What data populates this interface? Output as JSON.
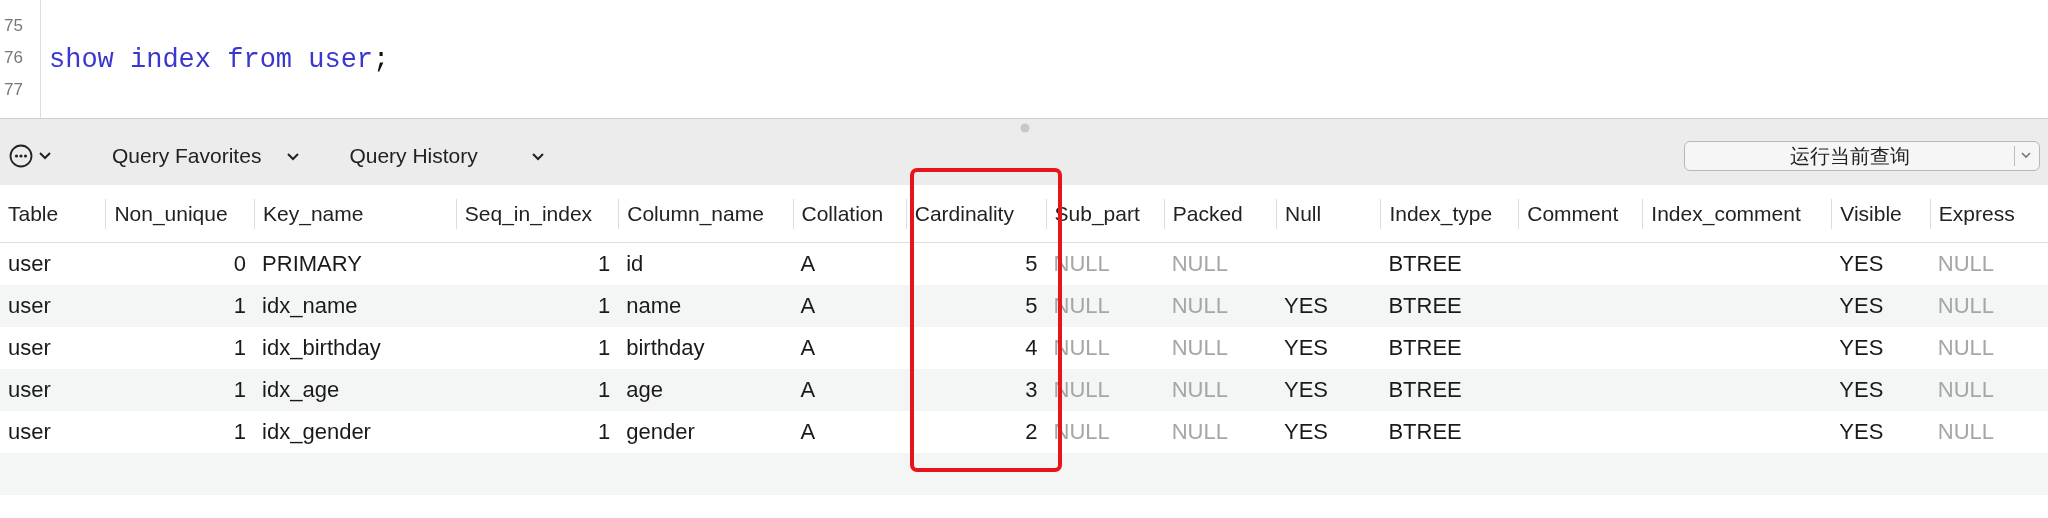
{
  "editor": {
    "lines": [
      {
        "number": "75"
      },
      {
        "number": "76",
        "code": {
          "keywords": "show index from user",
          "punct": ";"
        }
      },
      {
        "number": "77"
      }
    ]
  },
  "toolbar": {
    "favorites": "Query Favorites",
    "history": "Query History",
    "run_button": "运行当前查询"
  },
  "table": {
    "columns": [
      "Table",
      "Non_unique",
      "Key_name",
      "Seq_in_index",
      "Column_name",
      "Collation",
      "Cardinality",
      "Sub_part",
      "Packed",
      "Null",
      "Index_type",
      "Comment",
      "Index_comment",
      "Visible",
      "Express"
    ],
    "rows": [
      [
        "user",
        "0",
        "PRIMARY",
        "1",
        "id",
        "A",
        "5",
        {
          "text": "NULL",
          "is_null": true
        },
        {
          "text": "NULL",
          "is_null": true
        },
        null,
        "BTREE",
        null,
        null,
        "YES",
        {
          "text": "NULL",
          "is_null": true
        }
      ],
      [
        "user",
        "1",
        "idx_name",
        "1",
        "name",
        "A",
        "5",
        {
          "text": "NULL",
          "is_null": true
        },
        {
          "text": "NULL",
          "is_null": true
        },
        "YES",
        "BTREE",
        null,
        null,
        "YES",
        {
          "text": "NULL",
          "is_null": true
        }
      ],
      [
        "user",
        "1",
        "idx_birthday",
        "1",
        "birthday",
        "A",
        "4",
        {
          "text": "NULL",
          "is_null": true
        },
        {
          "text": "NULL",
          "is_null": true
        },
        "YES",
        "BTREE",
        null,
        null,
        "YES",
        {
          "text": "NULL",
          "is_null": true
        }
      ],
      [
        "user",
        "1",
        "idx_age",
        "1",
        "age",
        "A",
        "3",
        {
          "text": "NULL",
          "is_null": true
        },
        {
          "text": "NULL",
          "is_null": true
        },
        "YES",
        "BTREE",
        null,
        null,
        "YES",
        {
          "text": "NULL",
          "is_null": true
        }
      ],
      [
        "user",
        "1",
        "idx_gender",
        "1",
        "gender",
        "A",
        "2",
        {
          "text": "NULL",
          "is_null": true
        },
        {
          "text": "NULL",
          "is_null": true
        },
        "YES",
        "BTREE",
        null,
        null,
        "YES",
        {
          "text": "NULL",
          "is_null": true
        }
      ]
    ]
  }
}
